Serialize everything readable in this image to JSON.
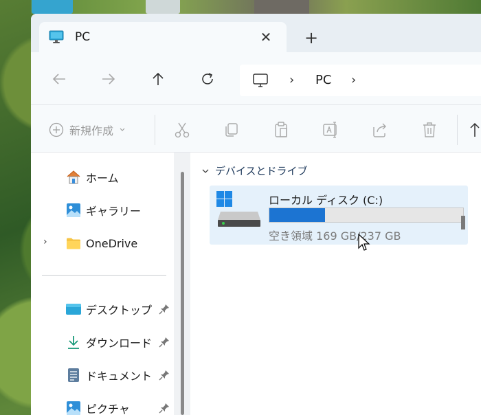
{
  "tab": {
    "title": "PC",
    "close_glyph": "✕",
    "new_glyph": "+"
  },
  "address": {
    "separator": "›",
    "location": "PC"
  },
  "command_bar": {
    "new_label": "新規作成"
  },
  "nav_pane": {
    "items": [
      {
        "label": "ホーム",
        "icon": "home-icon"
      },
      {
        "label": "ギャラリー",
        "icon": "gallery-icon"
      },
      {
        "label": "OneDrive",
        "icon": "folder-icon"
      },
      {
        "label": "デスクトップ",
        "icon": "desktop-icon"
      },
      {
        "label": "ダウンロード",
        "icon": "download-icon"
      },
      {
        "label": "ドキュメント",
        "icon": "document-icon"
      },
      {
        "label": "ピクチャ",
        "icon": "pictures-icon"
      }
    ]
  },
  "main": {
    "group_header": "デバイスとドライブ",
    "drive": {
      "name": "ローカル ディスク (C:)",
      "free_text": "空き領域 169 GB/237 GB",
      "used_fraction": 0.287
    }
  },
  "colors": {
    "accent": "#1c74d2",
    "tile_bg": "#e5f1fb",
    "window_bg": "#f7fafc"
  }
}
